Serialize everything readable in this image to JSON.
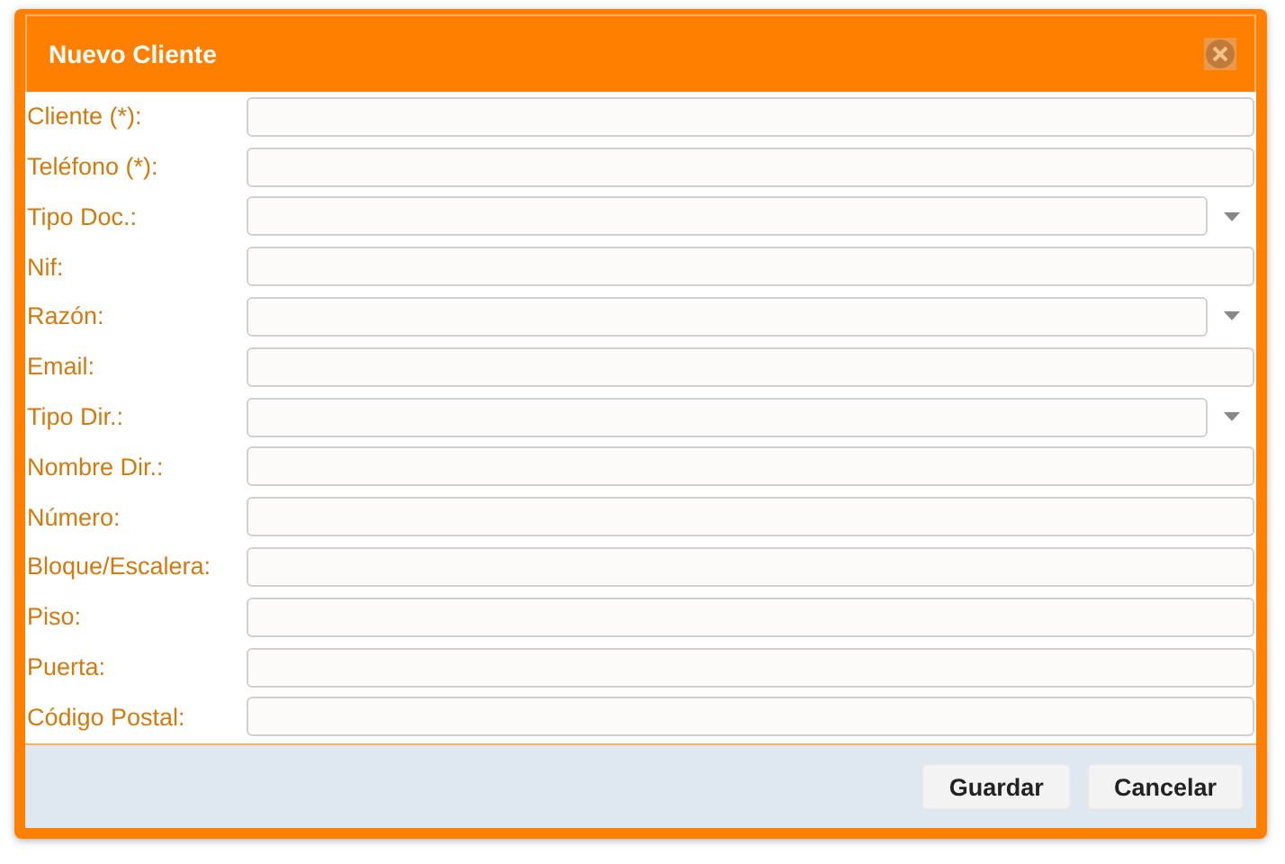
{
  "dialog": {
    "title": "Nuevo Cliente"
  },
  "fields": [
    {
      "label": "Cliente (*):",
      "kind": "text"
    },
    {
      "label": "Teléfono (*):",
      "kind": "text"
    },
    {
      "label": "Tipo Doc.:",
      "kind": "select"
    },
    {
      "label": "Nif:",
      "kind": "text"
    },
    {
      "label": "Razón:",
      "kind": "select"
    },
    {
      "label": "Email:",
      "kind": "text"
    },
    {
      "label": "Tipo Dir.:",
      "kind": "select"
    },
    {
      "label": "Nombre Dir.:",
      "kind": "text"
    },
    {
      "label": "Número:",
      "kind": "text"
    },
    {
      "label": "Bloque/Escalera:",
      "kind": "text"
    },
    {
      "label": "Piso:",
      "kind": "text"
    },
    {
      "label": "Puerta:",
      "kind": "text"
    },
    {
      "label": "Código Postal:",
      "kind": "text"
    }
  ],
  "buttons": [
    "Guardar",
    "Cancelar"
  ]
}
